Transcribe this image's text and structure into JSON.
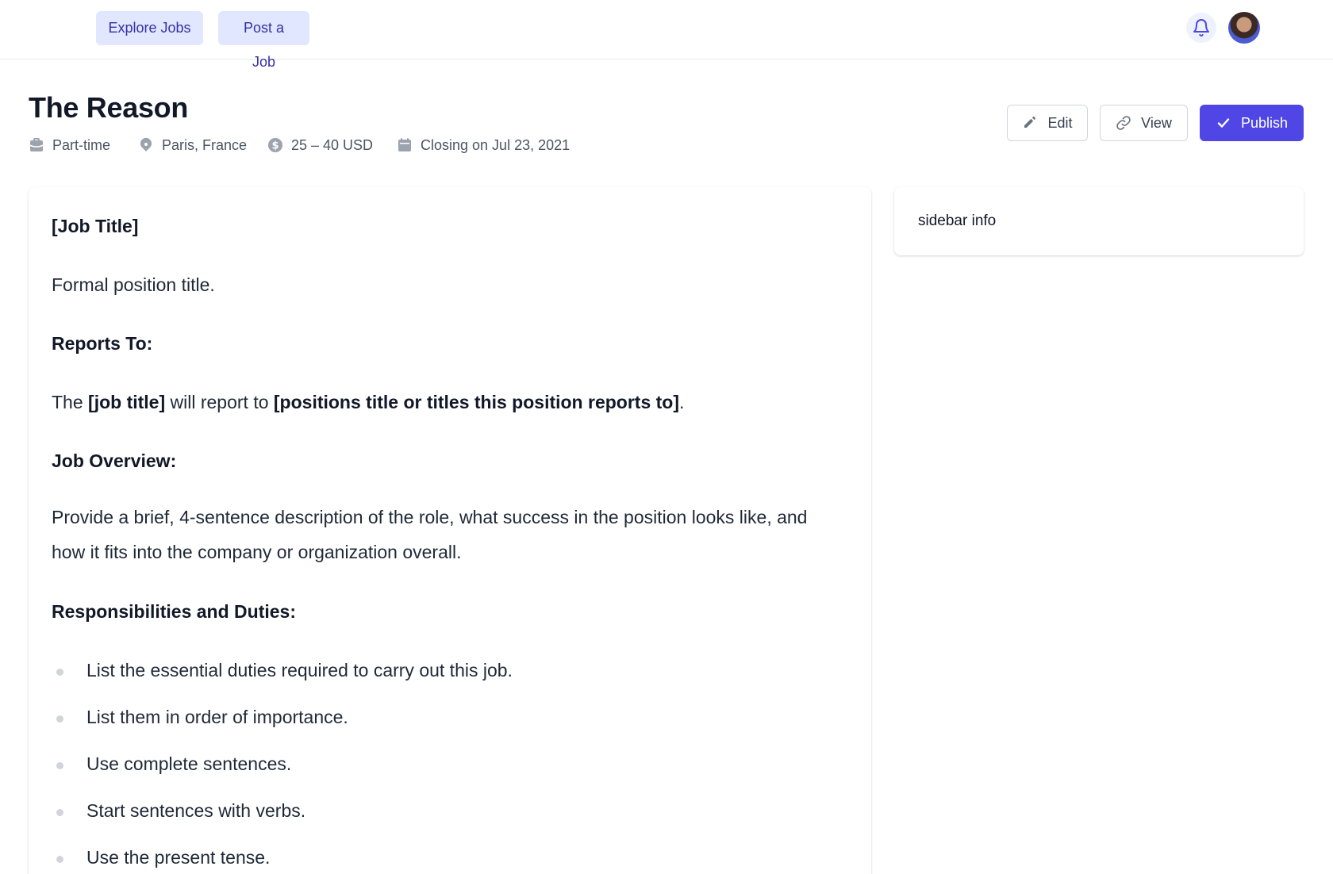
{
  "nav": {
    "explore_label": "Explore Jobs",
    "post_label": "Post a Job"
  },
  "header": {
    "title": "The Reason",
    "meta": {
      "type": "Part-time",
      "location": "Paris, France",
      "salary": "25 – 40 USD",
      "closing": "Closing on Jul 23, 2021"
    },
    "actions": {
      "edit": "Edit",
      "view": "View",
      "publish": "Publish"
    }
  },
  "content": {
    "h_job_title": "[Job Title]",
    "p_job_title": "Formal position title.",
    "h_reports": "Reports To:",
    "reports_prefix": "The ",
    "reports_bold1": "[job title]",
    "reports_mid": " will report to ",
    "reports_bold2": "[positions title or titles this position reports to]",
    "reports_end": ".",
    "h_overview": "Job Overview:",
    "p_overview": "Provide a brief, 4-sentence description of the role, what success in the position looks like, and how it fits into the company or organization overall.",
    "h_duties": "Responsibilities and Duties:",
    "duties": [
      "List the essential duties required to carry out this job.",
      "List them in order of importance.",
      "Use complete sentences.",
      "Start sentences with verbs.",
      "Use the present tense."
    ]
  },
  "sidebar": {
    "text": "sidebar info"
  },
  "colors": {
    "primary": "#4f46e5",
    "nav_bg": "#e0e7ff",
    "nav_text": "#3730a3"
  }
}
